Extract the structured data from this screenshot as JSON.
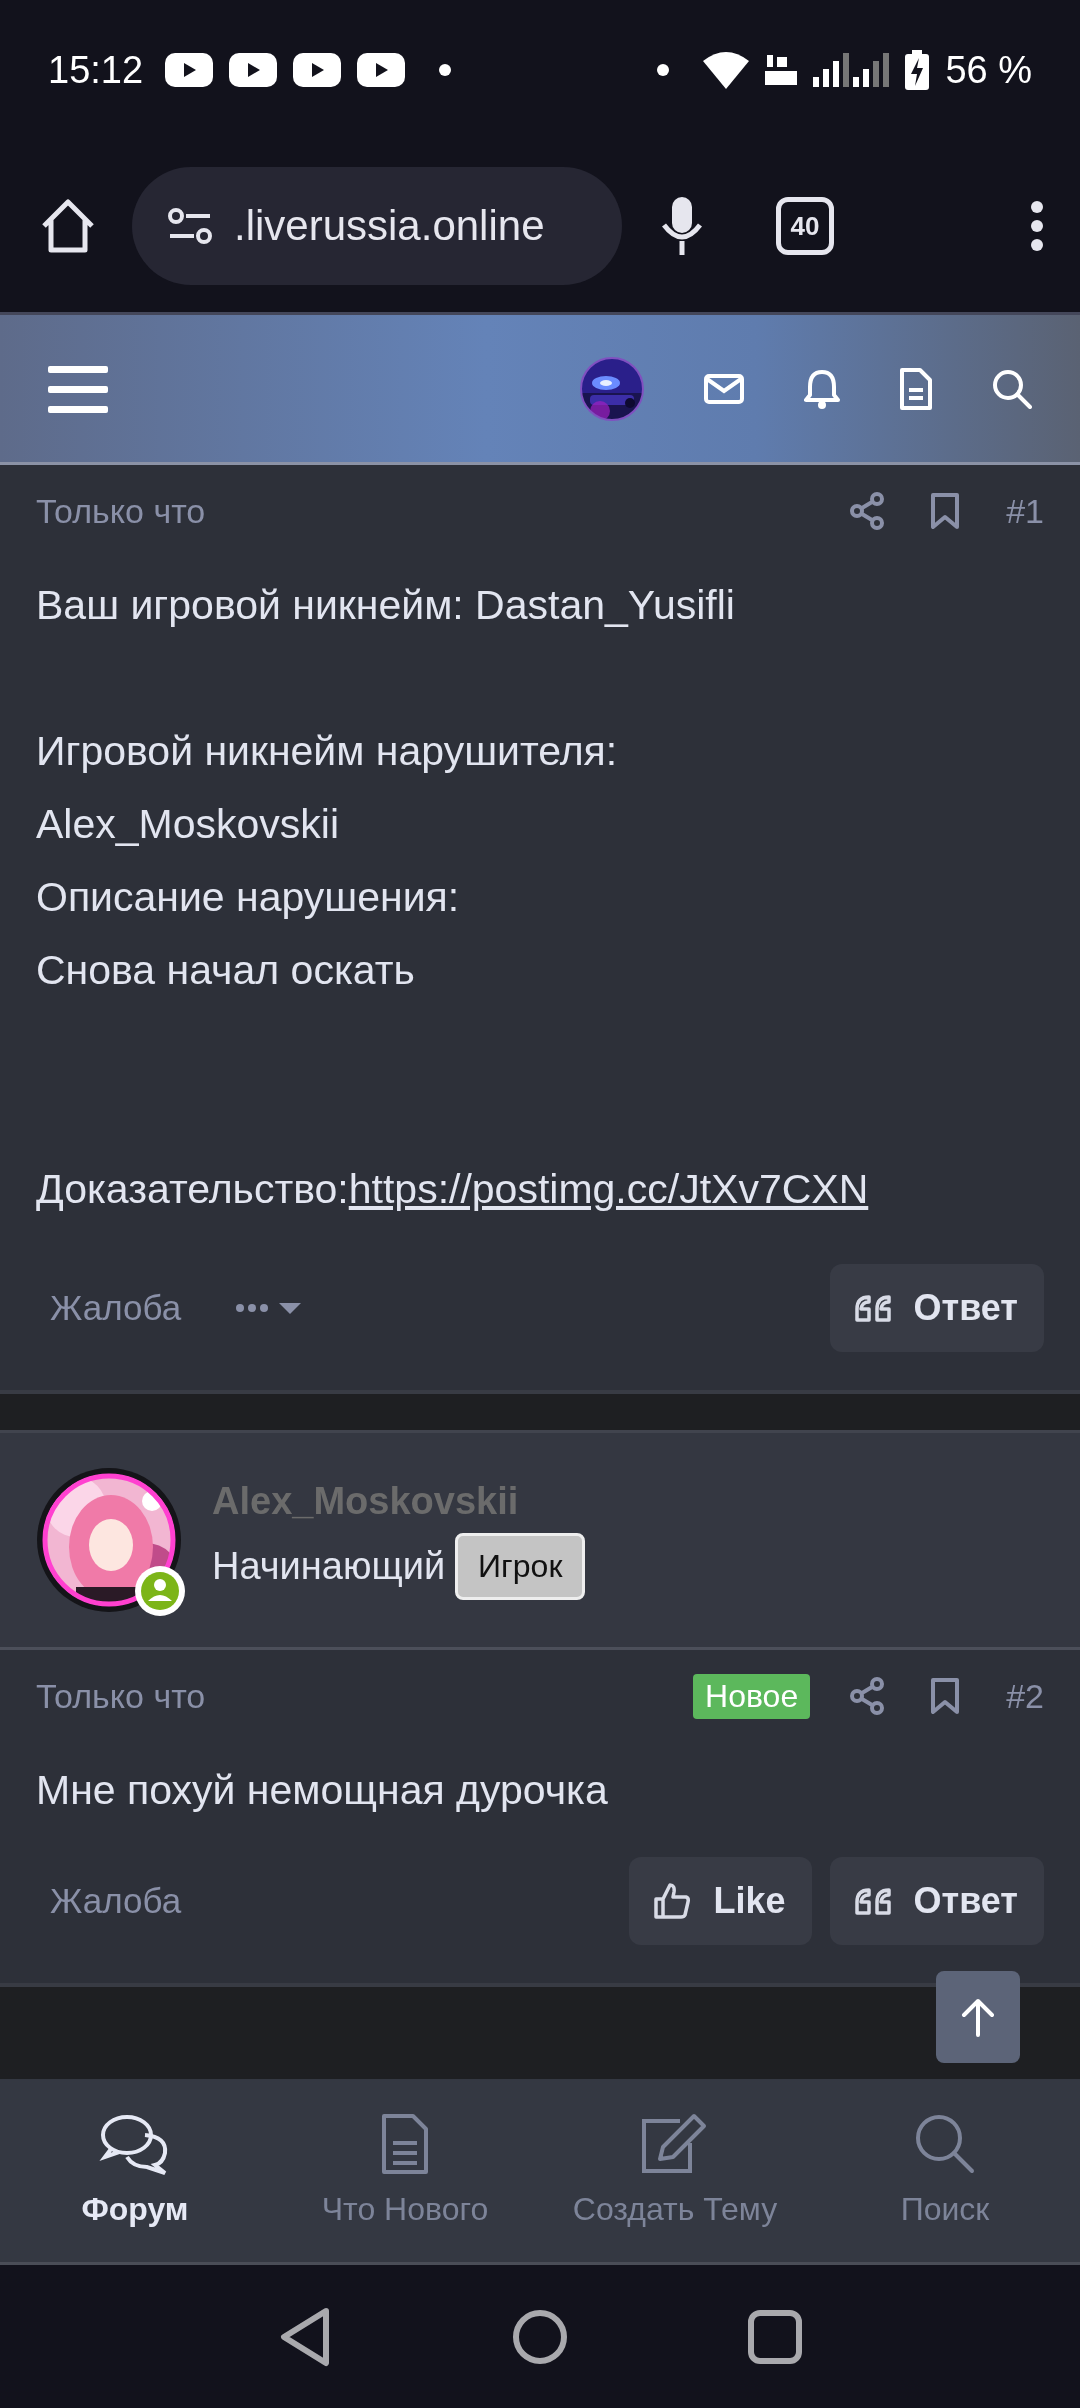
{
  "status_bar": {
    "time": "15:12",
    "battery": "56 %"
  },
  "browser": {
    "url": ".liverussia.online",
    "tab_count": "40"
  },
  "posts": [
    {
      "time": "Только что",
      "number": "#1",
      "more_menu": true,
      "report": "Жалоба",
      "paragraphs": [
        {
          "kind": "text",
          "lines": [
            "Ваш игровой никнейм: Dastan_Yusifli"
          ]
        },
        {
          "kind": "text",
          "lines": [
            "Игровой никнейм нарушителя:",
            "Alex_Moskovskii",
            "Описание нарушения:",
            "Снова начал оскать"
          ]
        },
        {
          "kind": "evidence",
          "label": "Доказательство:",
          "link": "https://postimg.cc/JtXv7CXN"
        }
      ],
      "buttons": [
        {
          "kind": "reply",
          "label": "Ответ"
        }
      ]
    },
    {
      "author": {
        "username": "Alex_Moskovskii",
        "title": "Начинающий",
        "group": "Игрок",
        "online": true
      },
      "time": "Только что",
      "badge": "Новое",
      "number": "#2",
      "more_menu": false,
      "report": "Жалоба",
      "paragraphs": [
        {
          "kind": "text",
          "lines": [
            "Мне похуй немощная дурочка"
          ]
        }
      ],
      "buttons": [
        {
          "kind": "like",
          "label": "Like"
        },
        {
          "kind": "reply",
          "label": "Ответ"
        }
      ]
    }
  ],
  "bottom_nav": {
    "items": [
      {
        "kind": "forum",
        "label": "Форум",
        "selected": true
      },
      {
        "kind": "news",
        "label": "Что Нового",
        "selected": false
      },
      {
        "kind": "create",
        "label": "Создать Тему",
        "selected": false
      },
      {
        "kind": "search",
        "label": "Поиск",
        "selected": false
      }
    ]
  }
}
